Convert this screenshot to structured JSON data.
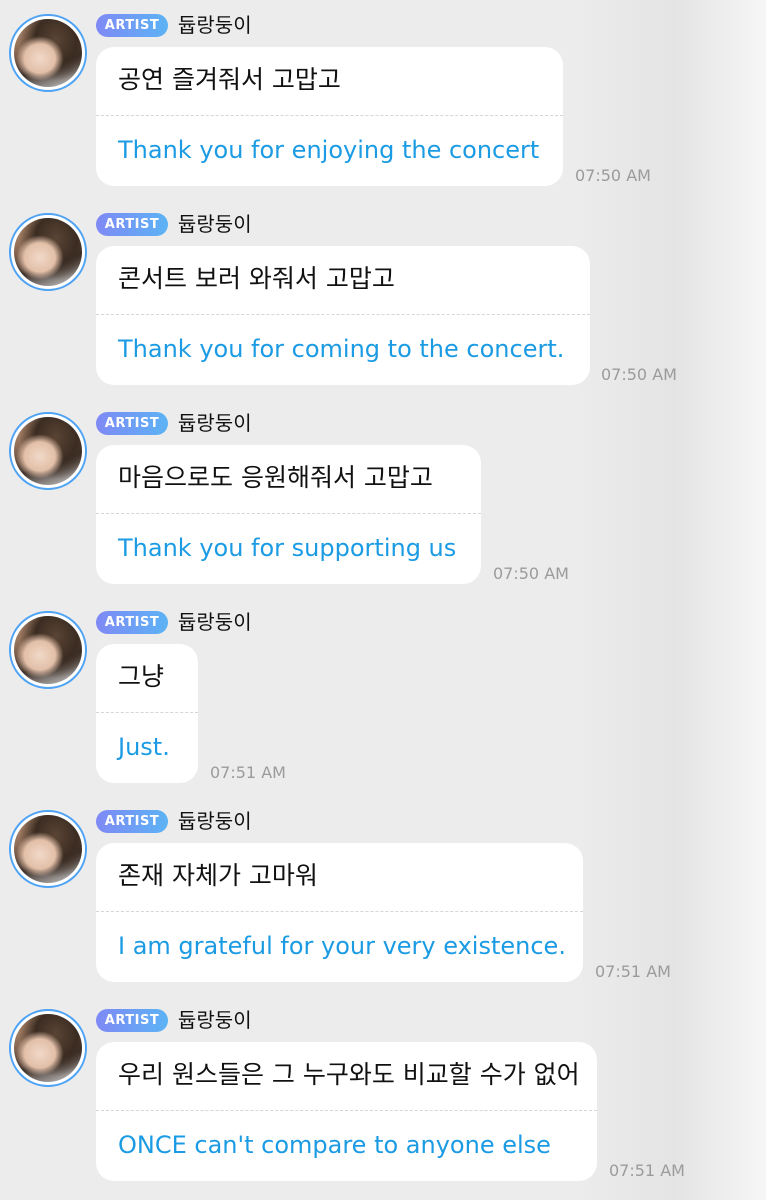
{
  "colors": {
    "translation_text": "#1b9be3",
    "badge_start": "#7f89f5",
    "badge_end": "#5cb3f5",
    "avatar_ring": "#4fa3f5",
    "timestamp": "#9b9b9b"
  },
  "messages": [
    {
      "badge": "ARTIST",
      "sender": "듑랑둥이",
      "korean": "공연 즐겨줘서 고맙고",
      "english": "Thank you for enjoying the concert",
      "time": "07:50 AM"
    },
    {
      "badge": "ARTIST",
      "sender": "듑랑둥이",
      "korean": "콘서트 보러 와줘서 고맙고",
      "english": "Thank you for coming to the concert.",
      "time": "07:50 AM"
    },
    {
      "badge": "ARTIST",
      "sender": "듑랑둥이",
      "korean": "마음으로도 응원해줘서 고맙고",
      "english": "Thank you for supporting us",
      "time": "07:50 AM"
    },
    {
      "badge": "ARTIST",
      "sender": "듑랑둥이",
      "korean": "그냥",
      "english": "Just.",
      "time": "07:51 AM"
    },
    {
      "badge": "ARTIST",
      "sender": "듑랑둥이",
      "korean": "존재 자체가 고마워",
      "english": "I am grateful for your very existence.",
      "time": "07:51 AM"
    },
    {
      "badge": "ARTIST",
      "sender": "듑랑둥이",
      "korean": "우리 원스들은 그 누구와도 비교할 수가 없어",
      "english": "ONCE can't compare to anyone else",
      "time": "07:51 AM"
    }
  ]
}
